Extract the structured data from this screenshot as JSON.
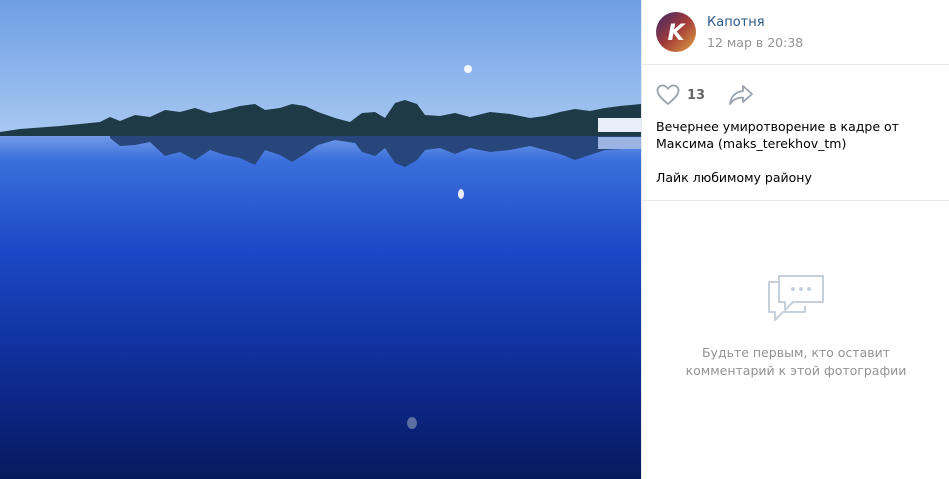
{
  "photo": {
    "description_icon": "photo-image"
  },
  "post": {
    "author": "Капотня",
    "date": "12 мар в 20:38",
    "avatar_letter": "K",
    "likes": "13",
    "description_line1": "Вечернее умиротворение в кадре от Максима (maks_terekhov_tm)",
    "description_line2": "Лайк любимому району"
  },
  "comments": {
    "empty_line1": "Будьте первым, кто оставит",
    "empty_line2": "комментарий к этой фотографии"
  },
  "icons": {
    "like": "heart-icon",
    "share": "share-arrow-icon",
    "comments": "comment-bubble-icon"
  },
  "colors": {
    "link": "#2a5885",
    "muted": "#939393",
    "divider": "#e7e8ec"
  }
}
